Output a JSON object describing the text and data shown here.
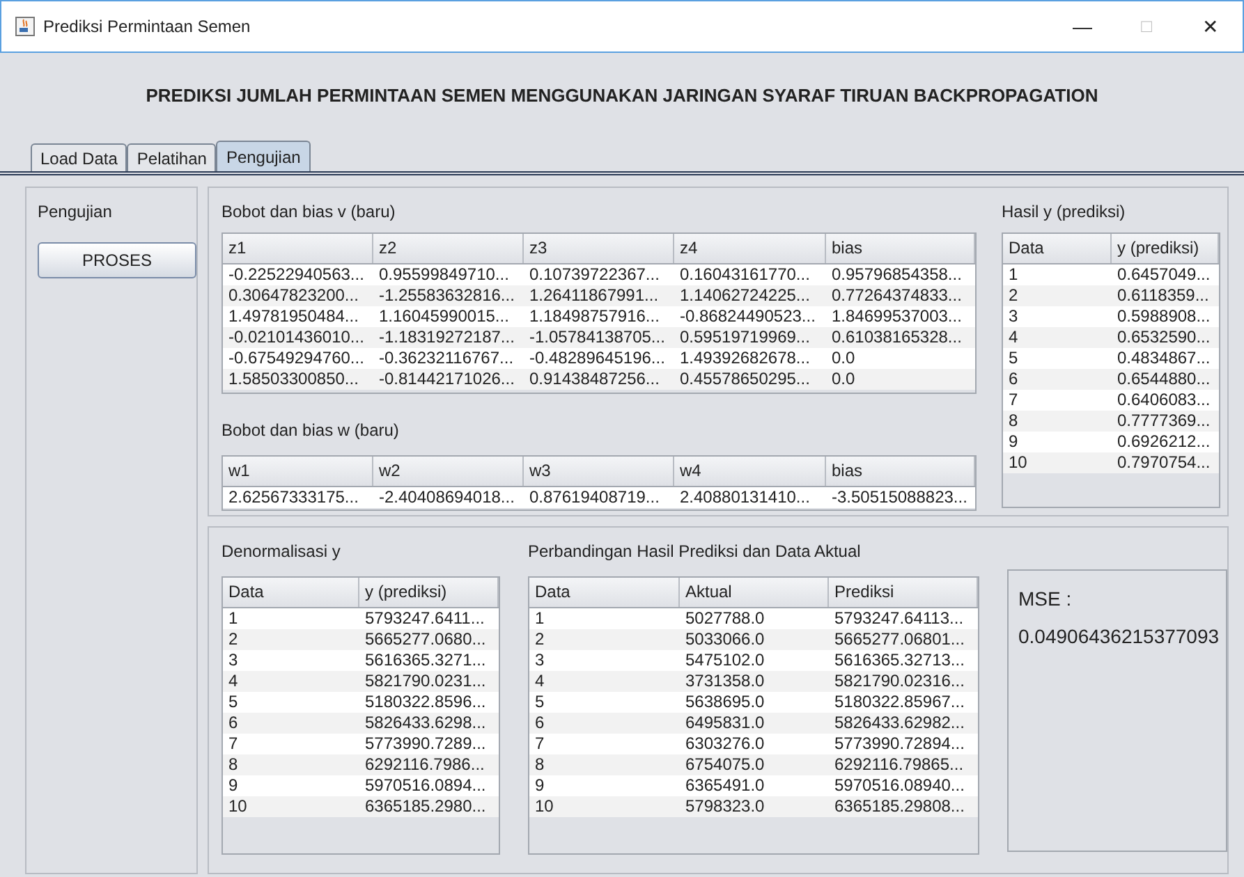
{
  "window": {
    "title": "Prediksi Permintaan Semen",
    "controls": [
      "—",
      "□",
      "✕"
    ]
  },
  "heading": "PREDIKSI JUMLAH PERMINTAAN SEMEN MENGGUNAKAN JARINGAN SYARAF TIRUAN BACKPROPAGATION",
  "tabs": [
    {
      "label": "Load Data",
      "selected": false
    },
    {
      "label": "Pelatihan",
      "selected": false
    },
    {
      "label": "Pengujian",
      "selected": true
    }
  ],
  "left_panel": {
    "title": "Pengujian",
    "button": "PROSES"
  },
  "v_table": {
    "title": "Bobot dan bias v (baru)",
    "columns": [
      "z1",
      "z2",
      "z3",
      "z4",
      "bias"
    ],
    "rows": [
      [
        "-0.22522940563...",
        "0.95599849710...",
        "0.10739722367...",
        "0.16043161770...",
        "0.95796854358..."
      ],
      [
        "0.30647823200...",
        "-1.25583632816...",
        "1.26411867991...",
        "1.14062724225...",
        "0.77264374833..."
      ],
      [
        "1.49781950484...",
        "1.16045990015...",
        "1.18498757916...",
        "-0.86824490523...",
        "1.84699537003..."
      ],
      [
        "-0.02101436010...",
        "-1.18319272187...",
        "-1.05784138705...",
        "0.59519719969...",
        "0.61038165328..."
      ],
      [
        "-0.67549294760...",
        "-0.36232116767...",
        "-0.48289645196...",
        "1.49392682678...",
        "0.0"
      ],
      [
        "1.58503300850...",
        "-0.81442171026...",
        "0.91438487256...",
        "0.45578650295...",
        "0.0"
      ]
    ]
  },
  "w_table": {
    "title": "Bobot dan bias w (baru)",
    "columns": [
      "w1",
      "w2",
      "w3",
      "w4",
      "bias"
    ],
    "rows": [
      [
        "2.62567333175...",
        "-2.40408694018...",
        "0.87619408719...",
        "2.40880131410...",
        "-3.50515088823..."
      ]
    ]
  },
  "hasil_table": {
    "title": "Hasil y (prediksi)",
    "columns": [
      "Data",
      "y (prediksi)"
    ],
    "rows": [
      [
        "1",
        "0.6457049..."
      ],
      [
        "2",
        "0.6118359..."
      ],
      [
        "3",
        "0.5988908..."
      ],
      [
        "4",
        "0.6532590..."
      ],
      [
        "5",
        "0.4834867..."
      ],
      [
        "6",
        "0.6544880..."
      ],
      [
        "7",
        "0.6406083..."
      ],
      [
        "8",
        "0.7777369..."
      ],
      [
        "9",
        "0.6926212..."
      ],
      [
        "10",
        "0.7970754..."
      ]
    ]
  },
  "denorm_table": {
    "title": "Denormalisasi y",
    "columns": [
      "Data",
      "y (prediksi)"
    ],
    "rows": [
      [
        "1",
        "5793247.6411..."
      ],
      [
        "2",
        "5665277.0680..."
      ],
      [
        "3",
        "5616365.3271..."
      ],
      [
        "4",
        "5821790.0231..."
      ],
      [
        "5",
        "5180322.8596..."
      ],
      [
        "6",
        "5826433.6298..."
      ],
      [
        "7",
        "5773990.7289..."
      ],
      [
        "8",
        "6292116.7986..."
      ],
      [
        "9",
        "5970516.0894..."
      ],
      [
        "10",
        "6365185.2980..."
      ]
    ]
  },
  "comparison_table": {
    "title": "Perbandingan Hasil Prediksi dan Data Aktual",
    "columns": [
      "Data",
      "Aktual",
      "Prediksi"
    ],
    "rows": [
      [
        "1",
        "5027788.0",
        "5793247.64113..."
      ],
      [
        "2",
        "5033066.0",
        "5665277.06801..."
      ],
      [
        "3",
        "5475102.0",
        "5616365.32713..."
      ],
      [
        "4",
        "3731358.0",
        "5821790.02316..."
      ],
      [
        "5",
        "5638695.0",
        "5180322.85967..."
      ],
      [
        "6",
        "6495831.0",
        "5826433.62982..."
      ],
      [
        "7",
        "6303276.0",
        "5773990.72894..."
      ],
      [
        "8",
        "6754075.0",
        "6292116.79865..."
      ],
      [
        "9",
        "6365491.0",
        "5970516.08940..."
      ],
      [
        "10",
        "5798323.0",
        "6365185.29808..."
      ]
    ]
  },
  "mse": {
    "label": "MSE :",
    "value": "0.04906436215377093"
  }
}
